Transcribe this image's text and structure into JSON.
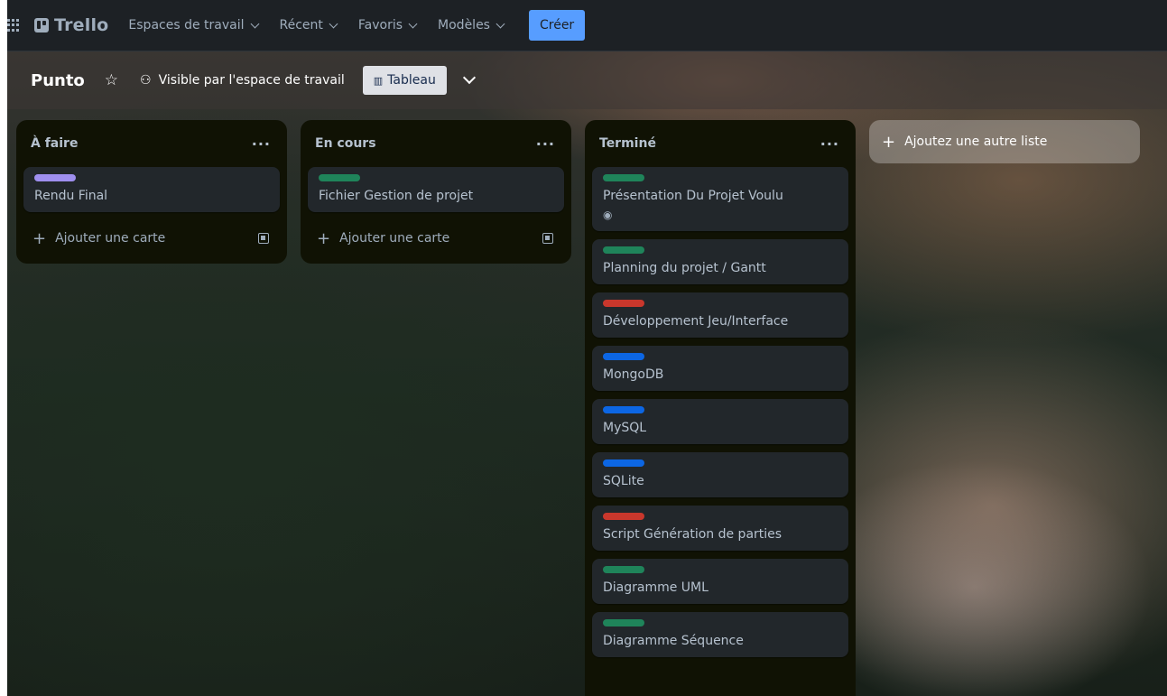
{
  "topnav": {
    "logo_text": "Trello",
    "items": [
      {
        "label": "Espaces de travail"
      },
      {
        "label": "Récent"
      },
      {
        "label": "Favoris"
      },
      {
        "label": "Modèles"
      }
    ],
    "create_label": "Créer",
    "create_color": "#579dff"
  },
  "board": {
    "title": "Punto",
    "visibility_label": "Visible par l'espace de travail",
    "view_label": "Tableau"
  },
  "lists": [
    {
      "title": "À faire",
      "cards": [
        {
          "title": "Rendu Final",
          "label_color": "#9f8fef"
        }
      ],
      "add_card_label": "Ajouter une carte"
    },
    {
      "title": "En cours",
      "cards": [
        {
          "title": "Fichier Gestion de projet",
          "label_color": "#1f845a"
        }
      ],
      "add_card_label": "Ajouter une carte"
    },
    {
      "title": "Terminé",
      "cards": [
        {
          "title": "Présentation Du Projet Voulu",
          "label_color": "#1f845a",
          "watch_icon": "eye-icon"
        },
        {
          "title": "Planning du projet / Gantt",
          "label_color": "#1f845a"
        },
        {
          "title": "Développement Jeu/Interface",
          "label_color": "#c9372c"
        },
        {
          "title": "MongoDB",
          "label_color": "#0c66e4"
        },
        {
          "title": "MySQL",
          "label_color": "#0c66e4"
        },
        {
          "title": "SQLite",
          "label_color": "#0c66e4"
        },
        {
          "title": "Script Génération de parties",
          "label_color": "#c9372c"
        },
        {
          "title": "Diagramme UML",
          "label_color": "#1f845a"
        },
        {
          "title": "Diagramme Séquence",
          "label_color": "#1f845a"
        }
      ]
    }
  ],
  "add_list_label": "Ajoutez une autre liste"
}
